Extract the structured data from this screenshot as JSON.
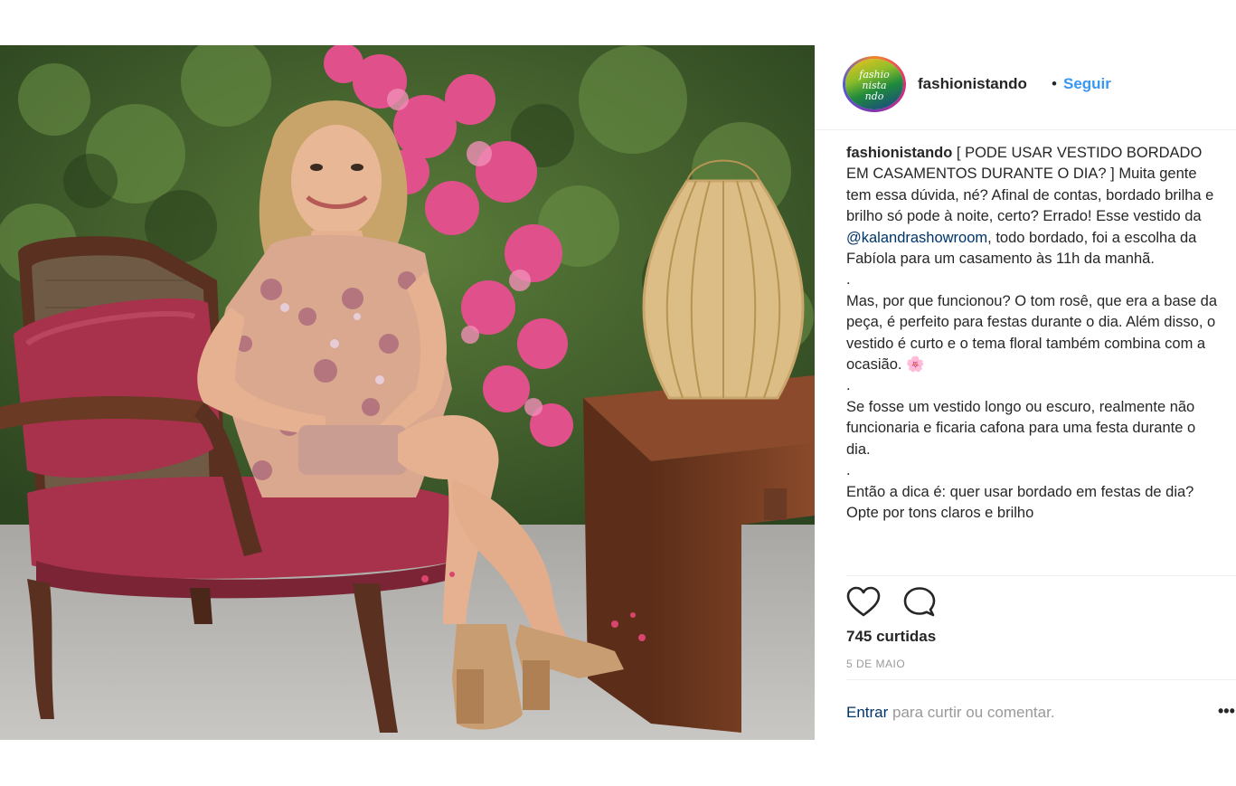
{
  "post": {
    "username": "fashionistando",
    "separator": "•",
    "follow_label": "Seguir",
    "avatar": {
      "icon": "fashionistando-logo",
      "lines": [
        "fashio",
        "nista",
        "ndo"
      ]
    },
    "caption": {
      "username": "fashionistando",
      "para1_before_mention": " [ PODE USAR VESTIDO BORDADO EM CASAMENTOS DURANTE O DIA? ] Muita gente tem essa dúvida, né? Afinal de contas, bordado brilha e brilho só pode à noite, certo? Errado! Esse vestido da ",
      "mention": "@kalandrashowroom",
      "para1_after_mention": ", todo bordado, foi a escolha da Fabíola para um casamento às 11h da manhã.",
      "sep1": ".",
      "para2": "Mas, por que funcionou? O tom rosê, que era a base da peça, é perfeito para festas durante o dia. Além disso, o vestido é curto e o tema floral também combina com a ocasião. ",
      "flower_emoji": "🌸",
      "sep2": ".",
      "para3": "Se fosse um vestido longo ou escuro, realmente não funcionaria e ficaria cafona para uma festa durante o dia.",
      "sep3": ".",
      "para4": "Então a dica é: quer usar bordado em festas de dia? Opte por tons claros e brilho"
    },
    "actions": {
      "like_icon": "heart-icon",
      "comment_icon": "comment-icon"
    },
    "likes_text": "745 curtidas",
    "date": "5 DE MAIO",
    "login": {
      "link": "Entrar",
      "rest": " para curtir ou comentar."
    },
    "more_icon": "•••",
    "image": {
      "description_icon": "photo",
      "colors": {
        "foliage": "#3d5a2c",
        "flowers": "#e0508a",
        "cushion": "#a8324b",
        "wood": "#6b3a24",
        "table": "#7a3f24",
        "ground": "#b9b6b2"
      }
    }
  },
  "colors": {
    "link_blue": "#3897f0",
    "text": "#262626",
    "muted": "#999999",
    "mention": "#003569"
  }
}
